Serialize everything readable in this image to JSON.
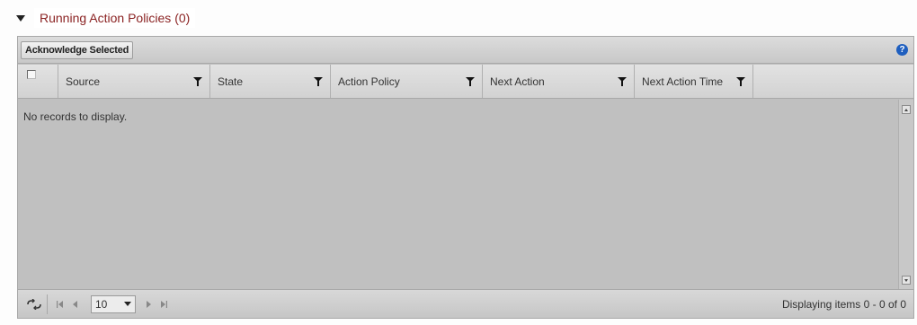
{
  "section": {
    "title": "Running Action Policies (0)"
  },
  "toolbar": {
    "acknowledge_label": "Acknowledge Selected",
    "help_symbol": "?"
  },
  "columns": [
    {
      "label": "Source"
    },
    {
      "label": "State"
    },
    {
      "label": "Action Policy"
    },
    {
      "label": "Next Action"
    },
    {
      "label": "Next Action Time"
    }
  ],
  "grid": {
    "empty_message": "No records to display."
  },
  "pager": {
    "page_size": "10",
    "info": "Displaying items 0 - 0 of 0"
  },
  "colors": {
    "title": "#8b2323",
    "grid_body": "#c0c0c0",
    "help_icon": "#1f5fbf"
  }
}
